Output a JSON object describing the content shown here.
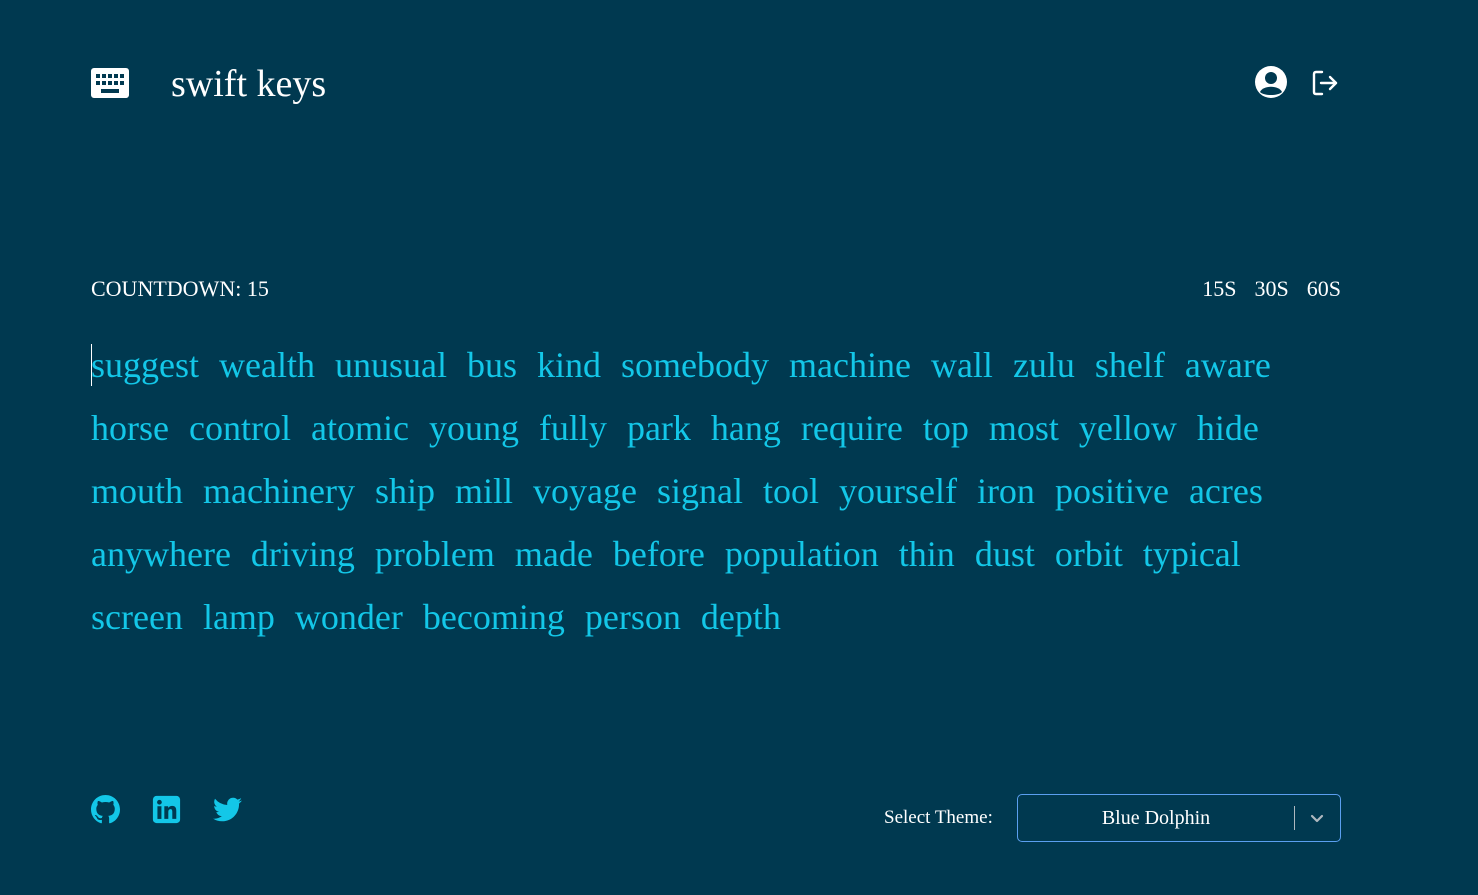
{
  "header": {
    "title": "swift keys",
    "logo_icon": "keyboard-icon",
    "user_icon": "user-circle-icon",
    "logout_icon": "logout-icon"
  },
  "test": {
    "countdown_label": "COUNTDOWN: 15",
    "durations": [
      "15S",
      "30S",
      "60S"
    ],
    "words": [
      "suggest",
      "wealth",
      "unusual",
      "bus",
      "kind",
      "somebody",
      "machine",
      "wall",
      "zulu",
      "shelf",
      "aware",
      "horse",
      "control",
      "atomic",
      "young",
      "fully",
      "park",
      "hang",
      "require",
      "top",
      "most",
      "yellow",
      "hide",
      "mouth",
      "machinery",
      "ship",
      "mill",
      "voyage",
      "signal",
      "tool",
      "yourself",
      "iron",
      "positive",
      "acres",
      "anywhere",
      "driving",
      "problem",
      "made",
      "before",
      "population",
      "thin",
      "dust",
      "orbit",
      "typical",
      "screen",
      "lamp",
      "wonder",
      "becoming",
      "person",
      "depth"
    ]
  },
  "footer": {
    "social_icons": [
      "github-icon",
      "linkedin-icon",
      "twitter-icon"
    ],
    "theme_label": "Select Theme:",
    "theme_value": "Blue Dolphin"
  },
  "colors": {
    "background": "#003950",
    "text": "#ffffff",
    "word_accent": "#13c7e8",
    "select_border": "#5b9ff0"
  }
}
